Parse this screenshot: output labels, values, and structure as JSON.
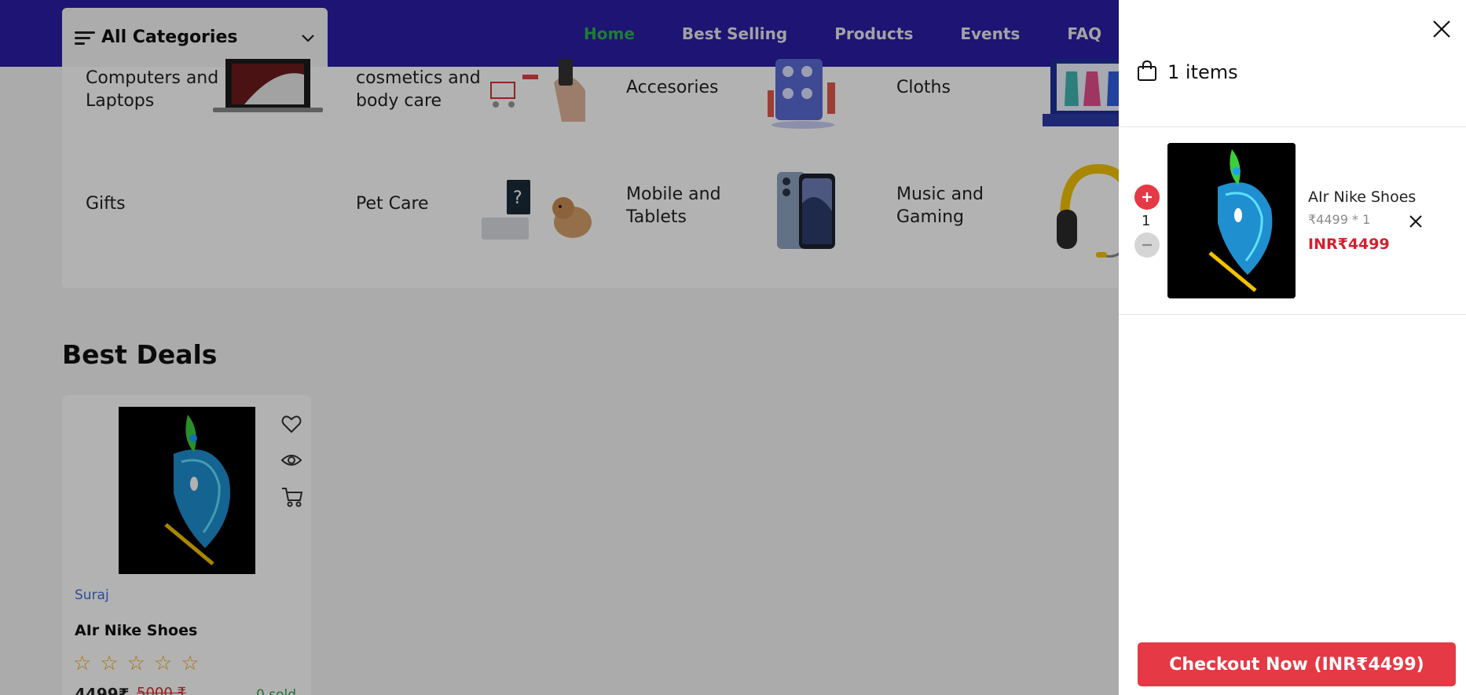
{
  "header": {
    "categories_label": "All Categories",
    "nav": [
      {
        "label": "Home",
        "active": true
      },
      {
        "label": "Best Selling",
        "active": false
      },
      {
        "label": "Products",
        "active": false
      },
      {
        "label": "Events",
        "active": false
      },
      {
        "label": "FAQ",
        "active": false
      }
    ]
  },
  "categories": [
    {
      "name": "Computers and Laptops"
    },
    {
      "name": "cosmetics and body care"
    },
    {
      "name": "Accesories"
    },
    {
      "name": "Cloths"
    },
    {
      "name": "Gifts"
    },
    {
      "name": "Pet Care"
    },
    {
      "name": "Mobile and Tablets"
    },
    {
      "name": "Music and Gaming"
    }
  ],
  "best_deals": {
    "title": "Best Deals",
    "product": {
      "shop": "Suraj",
      "name": "AIr Nike Shoes",
      "rating_stars": 5,
      "price": "4499₹",
      "original_price": "5000 ₹",
      "sold": "0 sold"
    }
  },
  "cart": {
    "items_count_label": "1 items",
    "item": {
      "name": "AIr Nike Shoes",
      "unit_price_line": "₹4499 * 1",
      "total": "INR₹4499",
      "quantity": "1"
    },
    "checkout_label": "Checkout Now (INR₹4499)"
  },
  "colors": {
    "header_bg": "#2a1da6",
    "nav_active": "#2bb24c",
    "accent_red": "#e53945",
    "star": "#f3a40b",
    "shop_link": "#3f6fd6",
    "sold": "#29a64b"
  }
}
